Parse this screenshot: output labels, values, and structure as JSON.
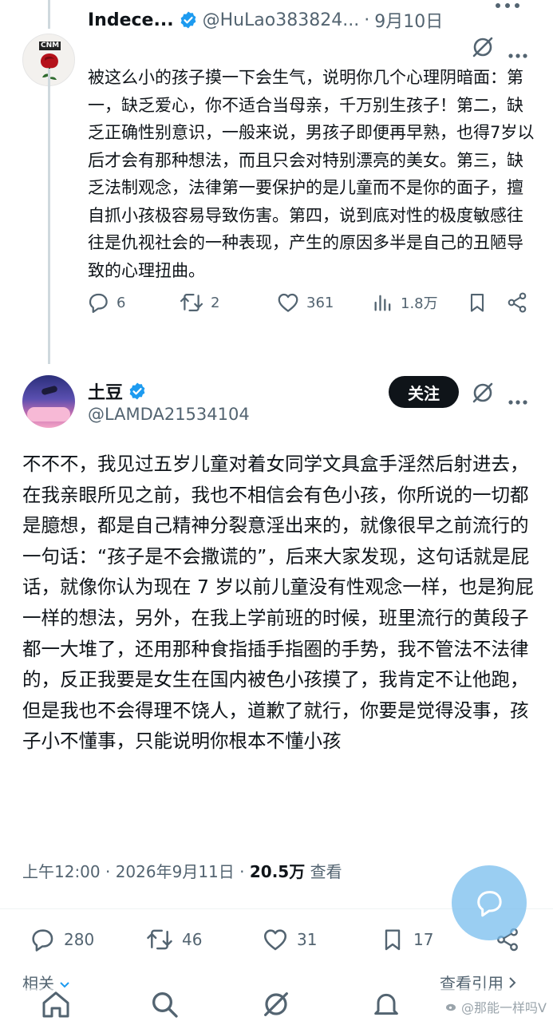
{
  "reply": {
    "name": "Indece...",
    "handle": "@HuLao383824...",
    "dot": "·",
    "date": "9月10日",
    "more": "···",
    "avatar_badge": "CNM",
    "text": "被这么小的孩子摸一下会生气，说明你几个心理阴暗面：第一，缺乏爱心，你不适合当母亲，千万别生孩子！第二，缺乏正确性别意识，一般来说，男孩子即便再早熟，也得7岁以后才会有那种想法，而且只会对特别漂亮的美女。第三，缺乏法制观念，法律第一要保护的是儿童而不是你的面子，擅自抓小孩极容易导致伤害。第四，说到底对性的极度敏感往往是仇视社会的一种表现，产生的原因多半是自己的丑陋导致的心理扭曲。",
    "actions": {
      "replies": "6",
      "retweets": "2",
      "likes": "361",
      "views": "1.8万"
    }
  },
  "main": {
    "name": "土豆",
    "handle": "@LAMDA21534104",
    "follow_label": "关注",
    "more": "···",
    "text": "不不不，我见过五岁儿童对着女同学文具盒手淫然后射进去，在我亲眼所见之前，我也不相信会有色小孩，你所说的一切都是臆想，都是自己精神分裂意淫出来的，就像很早之前流行的一句话：“孩子是不会撒谎的”，后来大家发现，这句话就是屁话，就像你认为现在 7 岁以前儿童没有性观念一样，也是狗屁一样的想法，另外，在我上学前班的时候，班里流行的黄段子都一大堆了，还用那种食指插手指圈的手势，我不管法不法律的，反正我要是女生在国内被色小孩摸了，我肯定不让他跑，但是我也不会得理不饶人，道歉了就行，你要是觉得没事，孩子小不懂事，只能说明你根本不懂小孩",
    "time": "上午12:00 · 2026年9月11日 · ",
    "views_count": "20.5万",
    "views_label": " 查看",
    "actions": {
      "replies": "280",
      "retweets": "46",
      "likes": "31",
      "bookmarks": "17"
    }
  },
  "footer": {
    "related": "相关",
    "view_quotes": "查看引用",
    "watermark": "@那能一样吗V"
  },
  "colors": {
    "accent": "#1d9bf0",
    "muted": "#536471",
    "text": "#0f1419"
  }
}
